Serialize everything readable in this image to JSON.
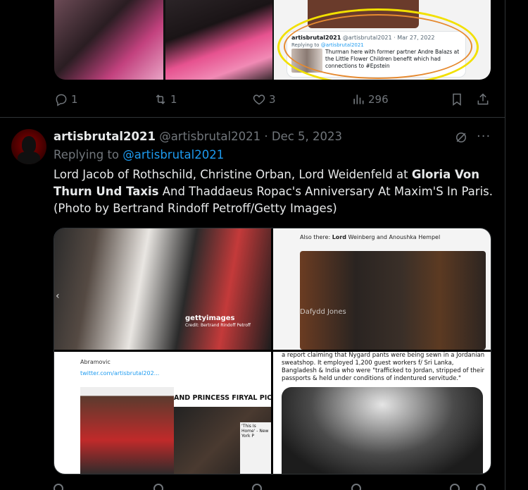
{
  "prev_tweet": {
    "quote": {
      "handle_name": "artisbrutal2021",
      "handle_at": "@artisbrutal2021",
      "date": "Mar 27, 2022",
      "replying_prefix": "Replying to",
      "replying_to": "@artisbrutal2021",
      "text": "Thurman here with former partner Andre Balazs at the Little Flower Children benefit which had connections to #Epstein"
    },
    "actions": {
      "replies": "1",
      "reposts": "1",
      "likes": "3",
      "views": "296"
    }
  },
  "tweet": {
    "display_name": "artisbrutal2021",
    "handle": "@artisbrutal2021",
    "dot": "·",
    "date": "Dec 5, 2023",
    "replying_prefix": "Replying to",
    "replying_to": "@artisbrutal2021",
    "text_part1": "Lord Jacob of Rothschild, Christine Orban, Lord Weidenfeld at ",
    "text_bold": "Gloria Von Thurn Und Taxis",
    "text_part2": " And Thaddaeus Ropac's Anniversary At Maxim'S In Paris. (Photo by Bertrand Rindoff Petroff/Getty Images)",
    "more": "···",
    "media": {
      "img1_watermark": "gettyimages",
      "img1_credit": "Credit: Bertrand Rindoff Petroff",
      "img2_also_prefix": "Also there: ",
      "img2_also_bold": "Lord",
      "img2_also_rest": " Weinberg and Anoushka Hempel",
      "img2_tag": "Dafydd Jones",
      "img3_line": "Abramovic",
      "img3_link": "twitter.com/artisbrutal202...",
      "img3_title": "AND PRINCESS FIRYAL PICTURE",
      "img3_news": "'This Is Home' - New York P",
      "img4_text": "a report claiming that Nygard pants were being sewn in a Jordanian sweatshop. It employed 1,200 guest workers f/ Sri Lanka, Bangladesh & India who were \"trafficked to Jordan, stripped of their passports & held under conditions of indentured servitude.\""
    }
  },
  "colors": {
    "background": "#000000",
    "text": "#e7e9ea",
    "muted": "#71767b",
    "link": "#1d9bf0",
    "border": "#2f3336"
  }
}
